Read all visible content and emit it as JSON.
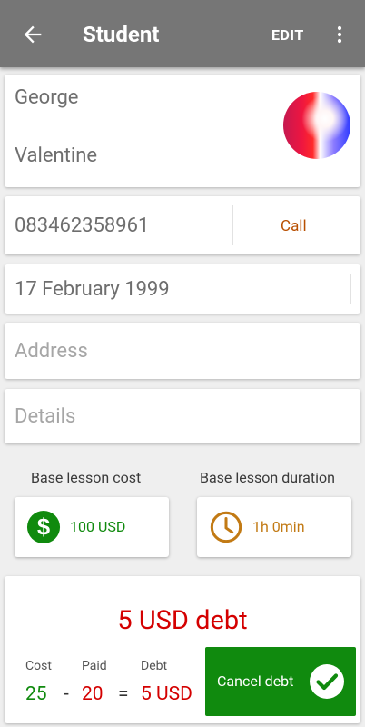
{
  "appbar": {
    "title": "Student",
    "edit_label": "EDIT",
    "back_icon": "arrow-left-icon",
    "more_icon": "more-vert-icon",
    "color": "#767676"
  },
  "student": {
    "first_name": "George",
    "last_name": "Valentine",
    "phone": "083462358961",
    "call_label": "Call",
    "birth_date": "17 February 1999",
    "address_placeholder": "Address",
    "details_placeholder": "Details"
  },
  "base": {
    "cost_label": "Base lesson cost",
    "cost_value": "100 USD",
    "cost_icon": "dollar-circle-icon",
    "cost_color": "#108a0e",
    "duration_label": "Base lesson duration",
    "duration_value": "1h 0min",
    "duration_icon": "clock-icon",
    "duration_color": "#c27a14"
  },
  "debt": {
    "title": "5 USD debt",
    "cost_label": "Cost",
    "paid_label": "Paid",
    "debt_label": "Debt",
    "cost_value": "25",
    "paid_value": "20",
    "debt_value": "5 USD",
    "minus": "-",
    "equals": "=",
    "cancel_label": "Cancel debt",
    "cancel_icon": "check-circle-icon",
    "debt_color": "#d40000",
    "cost_color": "#108a0e",
    "button_color": "#108a0e"
  }
}
